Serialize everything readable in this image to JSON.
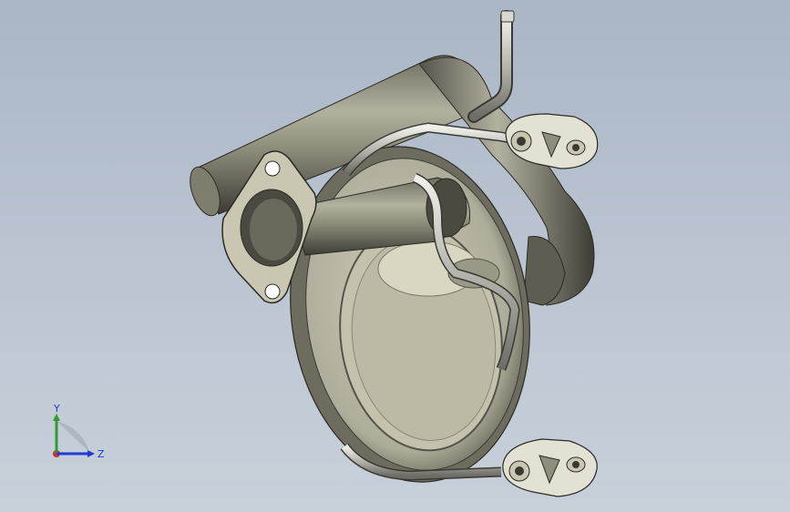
{
  "viewport": {
    "background_top": "#aab6c6",
    "background_bottom": "#c8d0da",
    "part_color": "#9c9a86",
    "part_dark": "#4a4a40",
    "tube_color": "#c9c9c2"
  },
  "triad": {
    "y_label": "Y",
    "z_label": "Z",
    "y_color": "#2e9d2e",
    "z_color": "#1f3bd6",
    "x_color": "#d62a2a"
  }
}
